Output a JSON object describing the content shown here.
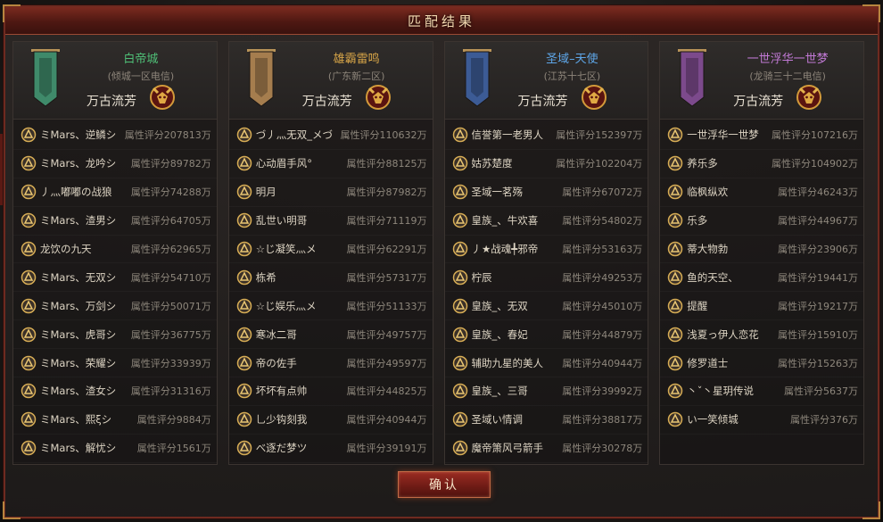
{
  "window": {
    "title": "匹配结果",
    "confirm_label": "确认"
  },
  "colors": {
    "server_names": [
      "#4fbf77",
      "#d9a648",
      "#5ea6e8",
      "#c27ad6"
    ],
    "banners": [
      "#3f8a6a",
      "#a57d4e",
      "#3c5b95",
      "#7c4a8c"
    ]
  },
  "panels": [
    {
      "server": "白帝城",
      "sub": "(倾城一区电信)",
      "guild": "万古流芳",
      "players": [
        {
          "name": "ミMars、逆鳞シ",
          "score": "属性评分207813万"
        },
        {
          "name": "ミMars、龙吟シ",
          "score": "属性评分89782万"
        },
        {
          "name": "丿灬嘟嘟の战狼",
          "score": "属性评分74288万"
        },
        {
          "name": "ミMars、渣男シ",
          "score": "属性评分64705万"
        },
        {
          "name": "龙饮の九天",
          "score": "属性评分62965万"
        },
        {
          "name": "ミMars、无双シ",
          "score": "属性评分54710万"
        },
        {
          "name": "ミMars、万剑シ",
          "score": "属性评分50071万"
        },
        {
          "name": "ミMars、虎哥シ",
          "score": "属性评分36775万"
        },
        {
          "name": "ミMars、荣耀シ",
          "score": "属性评分33939万"
        },
        {
          "name": "ミMars、渣女シ",
          "score": "属性评分31316万"
        },
        {
          "name": "ミMars、熙ξシ",
          "score": "属性评分9884万"
        },
        {
          "name": "ミMars、解忧シ",
          "score": "属性评分1561万"
        }
      ]
    },
    {
      "server": "雄霸雷鸣",
      "sub": "(广东新二区)",
      "guild": "万古流芳",
      "players": [
        {
          "name": "づ丿灬无双_メづ",
          "score": "属性评分110632万"
        },
        {
          "name": "心动眉手风°",
          "score": "属性评分88125万"
        },
        {
          "name": "明月",
          "score": "属性评分87982万"
        },
        {
          "name": "乱世い明哥",
          "score": "属性评分71119万"
        },
        {
          "name": "☆じ凝笑灬メ",
          "score": "属性评分62291万"
        },
        {
          "name": "栋希",
          "score": "属性评分57317万"
        },
        {
          "name": "☆じ娱乐灬メ",
          "score": "属性评分51133万"
        },
        {
          "name": "寒冰二哥",
          "score": "属性评分49757万"
        },
        {
          "name": "帝の佐手",
          "score": "属性评分49597万"
        },
        {
          "name": "坏坏有点帅",
          "score": "属性评分44825万"
        },
        {
          "name": "乚少钩刻我",
          "score": "属性评分40944万"
        },
        {
          "name": "べ逐だ梦ツ",
          "score": "属性评分39191万"
        }
      ]
    },
    {
      "server": "圣域–天使",
      "sub": "(江苏十七区)",
      "guild": "万古流芳",
      "players": [
        {
          "name": "信誉第一老男人",
          "score": "属性评分152397万"
        },
        {
          "name": "姑苏楚度",
          "score": "属性评分102204万"
        },
        {
          "name": "圣域一茗殇",
          "score": "属性评分67072万"
        },
        {
          "name": "皇族_、牛欢喜",
          "score": "属性评分54802万"
        },
        {
          "name": "丿★战魂╇邪帝",
          "score": "属性评分53163万"
        },
        {
          "name": "柠辰",
          "score": "属性评分49253万"
        },
        {
          "name": "皇族_、无双",
          "score": "属性评分45010万"
        },
        {
          "name": "皇族_、春妃",
          "score": "属性评分44879万"
        },
        {
          "name": "辅助九星的美人",
          "score": "属性评分40944万"
        },
        {
          "name": "皇族_、三哥",
          "score": "属性评分39992万"
        },
        {
          "name": "圣域い情调",
          "score": "属性评分38817万"
        },
        {
          "name": "魔帝箫风弓箭手",
          "score": "属性评分30278万"
        }
      ]
    },
    {
      "server": "一世浮华一世梦",
      "sub": "(龙骑三十二电信)",
      "guild": "万古流芳",
      "players": [
        {
          "name": "一世浮华一世梦",
          "score": "属性评分107216万"
        },
        {
          "name": "养乐多",
          "score": "属性评分104902万"
        },
        {
          "name": "临枫纵欢",
          "score": "属性评分46243万"
        },
        {
          "name": "乐多",
          "score": "属性评分44967万"
        },
        {
          "name": "蒂大物勃",
          "score": "属性评分23906万"
        },
        {
          "name": "鱼的天空、",
          "score": "属性评分19441万"
        },
        {
          "name": "提醒",
          "score": "属性评分19217万"
        },
        {
          "name": "浅夏っ伊人恋花",
          "score": "属性评分15910万"
        },
        {
          "name": "修罗道士",
          "score": "属性评分15263万"
        },
        {
          "name": "丶ˇ丶星玥传说",
          "score": "属性评分5637万"
        },
        {
          "name": "い一笑倾城",
          "score": "属性评分376万"
        }
      ]
    }
  ]
}
